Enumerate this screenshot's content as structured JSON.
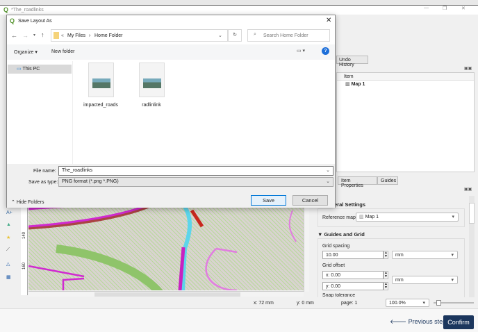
{
  "window": {
    "title": "*The_roadlinks"
  },
  "dialog": {
    "title": "Save Layout As",
    "breadcrumb": [
      "My Files",
      "Home Folder"
    ],
    "breadcrumb_prefix": "«",
    "search_placeholder": "Search Home Folder",
    "organize": "Organize ▾",
    "new_folder": "New folder",
    "sidebar": [
      {
        "label": "This PC"
      }
    ],
    "files": [
      {
        "name": "impacted_roads"
      },
      {
        "name": "radlinlink"
      }
    ],
    "file_name_label": "File name:",
    "file_name": "The_roadlinks",
    "type_label": "Save as type:",
    "type_value": "PNG format (*.png *.PNG)",
    "hide_folders": "Hide Folders",
    "save": "Save",
    "cancel": "Cancel"
  },
  "right_panel": {
    "tab_undo": "Undo History",
    "col_item": "Item",
    "items": [
      "Map 1"
    ],
    "tabs": [
      "Item Properties",
      "Guides"
    ],
    "general_settings": "eral Settings",
    "reference_map_label": "Reference map",
    "reference_map": "Map 1",
    "guides_and_grid": "Guides and Grid",
    "grid_spacing_label": "Grid spacing",
    "grid_spacing": "10.00",
    "grid_spacing_unit": "mm",
    "grid_offset_label": "Grid offset",
    "offset_x": "x: 0.00",
    "offset_y": "y: 0.00",
    "offset_unit": "mm",
    "snap_tolerance": "Snap tolerance"
  },
  "ruler": {
    "labels": [
      "140",
      "160"
    ]
  },
  "status": {
    "x": "x: 72 mm",
    "y": "y: 0 mm",
    "page": "page: 1",
    "zoom": "100.0%"
  },
  "footer": {
    "previous": "Previous step",
    "confirm": "Confirm"
  },
  "colors": {
    "confirm": "#1b365d",
    "accent": "#0078d7"
  }
}
